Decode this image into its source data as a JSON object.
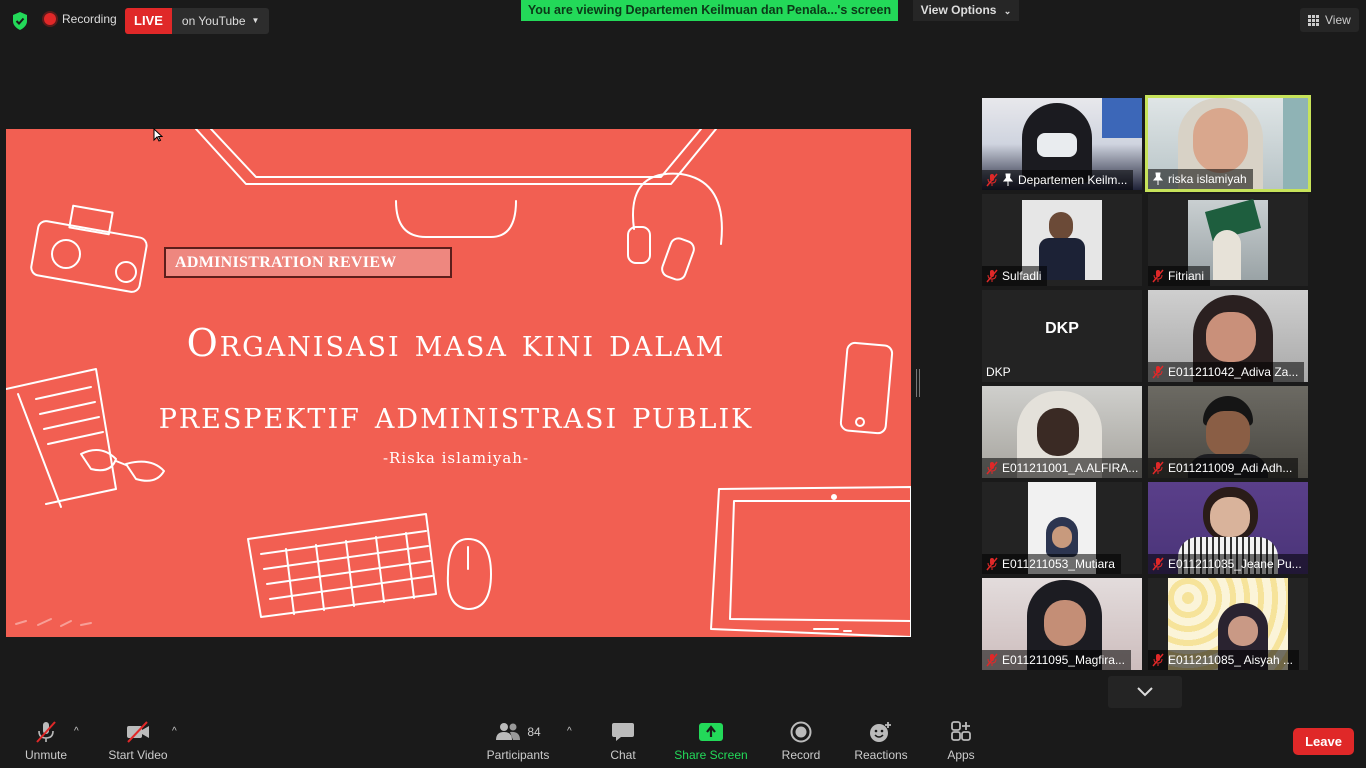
{
  "top_bar": {
    "recording_label": "Recording",
    "live_label": "LIVE",
    "live_target": "on YouTube",
    "viewing_banner": "You are viewing Departemen Keilmuan dan Penala...'s screen",
    "view_options_label": "View Options",
    "view_label": "View"
  },
  "slide": {
    "badge": "ADMINISTRATION REVIEW",
    "title_line1": "Organisasi masa kini dalam",
    "title_line2": "prespektif administrasi publik",
    "author": "-Riska islamiyah-",
    "background_color": "#f25f52"
  },
  "participants": [
    {
      "name": "Departemen Keilm...",
      "muted": true,
      "pinned": true
    },
    {
      "name": "riska islamiyah",
      "muted": false,
      "pinned": true,
      "active_speaker": true
    },
    {
      "name": "Sulfadli",
      "muted": true
    },
    {
      "name": "Fitriani",
      "muted": true
    },
    {
      "name": "DKP",
      "muted": false,
      "initials": "DKP"
    },
    {
      "name": "E011211042_Adiva Za...",
      "muted": true
    },
    {
      "name": "E011211001_A.ALFIRA...",
      "muted": true
    },
    {
      "name": "E011211009_Adi Adh...",
      "muted": true
    },
    {
      "name": "E011211053_Mutiara",
      "muted": true
    },
    {
      "name": "E011211035_Jeane Pu...",
      "muted": true
    },
    {
      "name": "E011211095_Magfira...",
      "muted": true
    },
    {
      "name": "E011211085_ Aisyah ...",
      "muted": true
    }
  ],
  "toolbar": {
    "unmute_label": "Unmute",
    "start_video_label": "Start Video",
    "participants_label": "Participants",
    "participants_count": "84",
    "chat_label": "Chat",
    "share_screen_label": "Share Screen",
    "record_label": "Record",
    "reactions_label": "Reactions",
    "apps_label": "Apps",
    "leave_label": "Leave"
  },
  "colors": {
    "accent_green": "#23d959",
    "leave_red": "#e02828",
    "active_speaker_border": "#c7e35a"
  }
}
